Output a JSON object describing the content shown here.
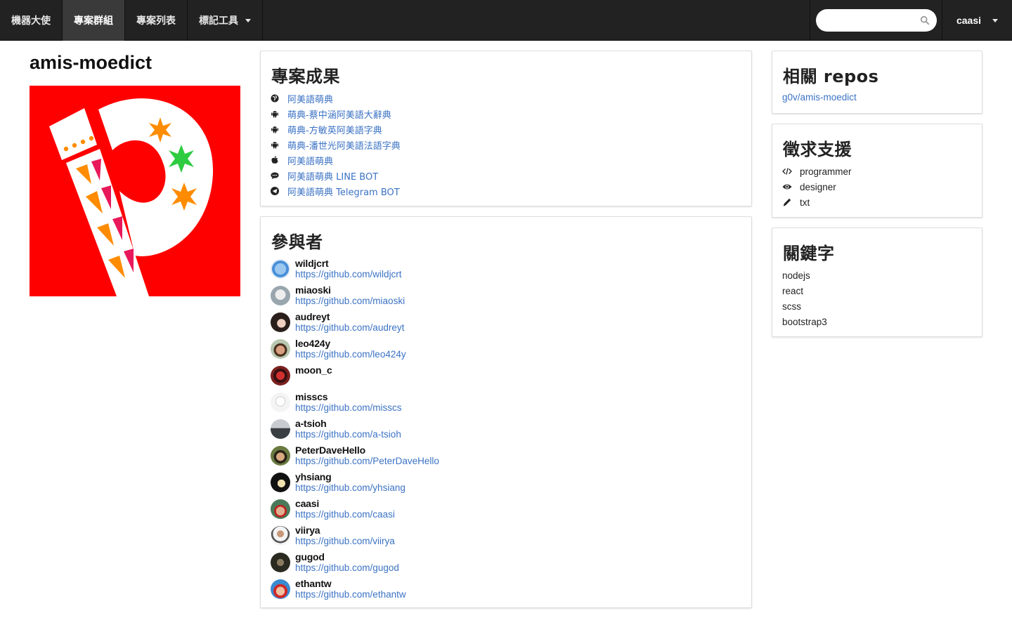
{
  "nav": {
    "items": [
      {
        "label": "機器大使",
        "active": false,
        "dropdown": false
      },
      {
        "label": "專案群組",
        "active": true,
        "dropdown": false
      },
      {
        "label": "專案列表",
        "active": false,
        "dropdown": false
      },
      {
        "label": "標記工具",
        "active": false,
        "dropdown": true
      }
    ],
    "search_placeholder": "",
    "search_icon": "search-icon",
    "user": "caasi"
  },
  "project": {
    "title": "amis-moedict",
    "logo_colors": {
      "background": "#ff0000",
      "primary": "#ffffff",
      "accent_orange": "#ff8c00",
      "accent_pink": "#e8195a",
      "accent_green": "#2ecc40"
    }
  },
  "results": {
    "heading": "專案成果",
    "links": [
      {
        "icon": "globe-icon",
        "label": "阿美語萌典"
      },
      {
        "icon": "android-icon",
        "label": "萌典-蔡中涵阿美語大辭典"
      },
      {
        "icon": "android-icon",
        "label": "萌典-方敏英阿美語字典"
      },
      {
        "icon": "android-icon",
        "label": "萌典-潘世光阿美語法語字典"
      },
      {
        "icon": "apple-icon",
        "label": "阿美語萌典"
      },
      {
        "icon": "chat-icon",
        "label": "阿美語萌典 LINE BOT"
      },
      {
        "icon": "telegram-icon",
        "label": "阿美語萌典 Telegram BOT"
      }
    ]
  },
  "participants": {
    "heading": "參與者",
    "people": [
      {
        "name": "wildjcrt",
        "url": "https://github.com/wildjcrt",
        "color": "#4a90d9"
      },
      {
        "name": "miaoski",
        "url": "https://github.com/miaoski",
        "color": "#b8c4cc"
      },
      {
        "name": "audreyt",
        "url": "https://github.com/audreyt",
        "color": "#5a4a40"
      },
      {
        "name": "leo424y",
        "url": "https://github.com/leo424y",
        "color": "#7a5a40"
      },
      {
        "name": "moon_c",
        "url": "",
        "color": "#9a2020"
      },
      {
        "name": "misscs",
        "url": "https://github.com/misscs",
        "color": "#e8e8e8"
      },
      {
        "name": "a-tsioh",
        "url": "https://github.com/a-tsioh",
        "color": "#6a7480"
      },
      {
        "name": "PeterDaveHello",
        "url": "https://github.com/PeterDaveHello",
        "color": "#4a5a30"
      },
      {
        "name": "yhsiang",
        "url": "https://github.com/yhsiang",
        "color": "#2a2a2a"
      },
      {
        "name": "caasi",
        "url": "https://github.com/caasi",
        "color": "#c04040"
      },
      {
        "name": "viirya",
        "url": "https://github.com/viirya",
        "color": "#d8d8d8"
      },
      {
        "name": "gugod",
        "url": "https://github.com/gugod",
        "color": "#3a3a30"
      },
      {
        "name": "ethantw",
        "url": "https://github.com/ethantw",
        "color": "#d04040"
      }
    ]
  },
  "repos": {
    "heading": "相關 repos",
    "items": [
      "g0v/amis-moedict"
    ]
  },
  "help": {
    "heading": "徵求支援",
    "items": [
      {
        "icon": "code-icon",
        "label": "programmer"
      },
      {
        "icon": "eye-icon",
        "label": "designer"
      },
      {
        "icon": "pencil-icon",
        "label": "txt"
      }
    ]
  },
  "keywords": {
    "heading": "關鍵字",
    "items": [
      "nodejs",
      "react",
      "scss",
      "bootstrap3"
    ]
  },
  "colors": {
    "navbar": "#222222",
    "link": "#3b73c4"
  }
}
